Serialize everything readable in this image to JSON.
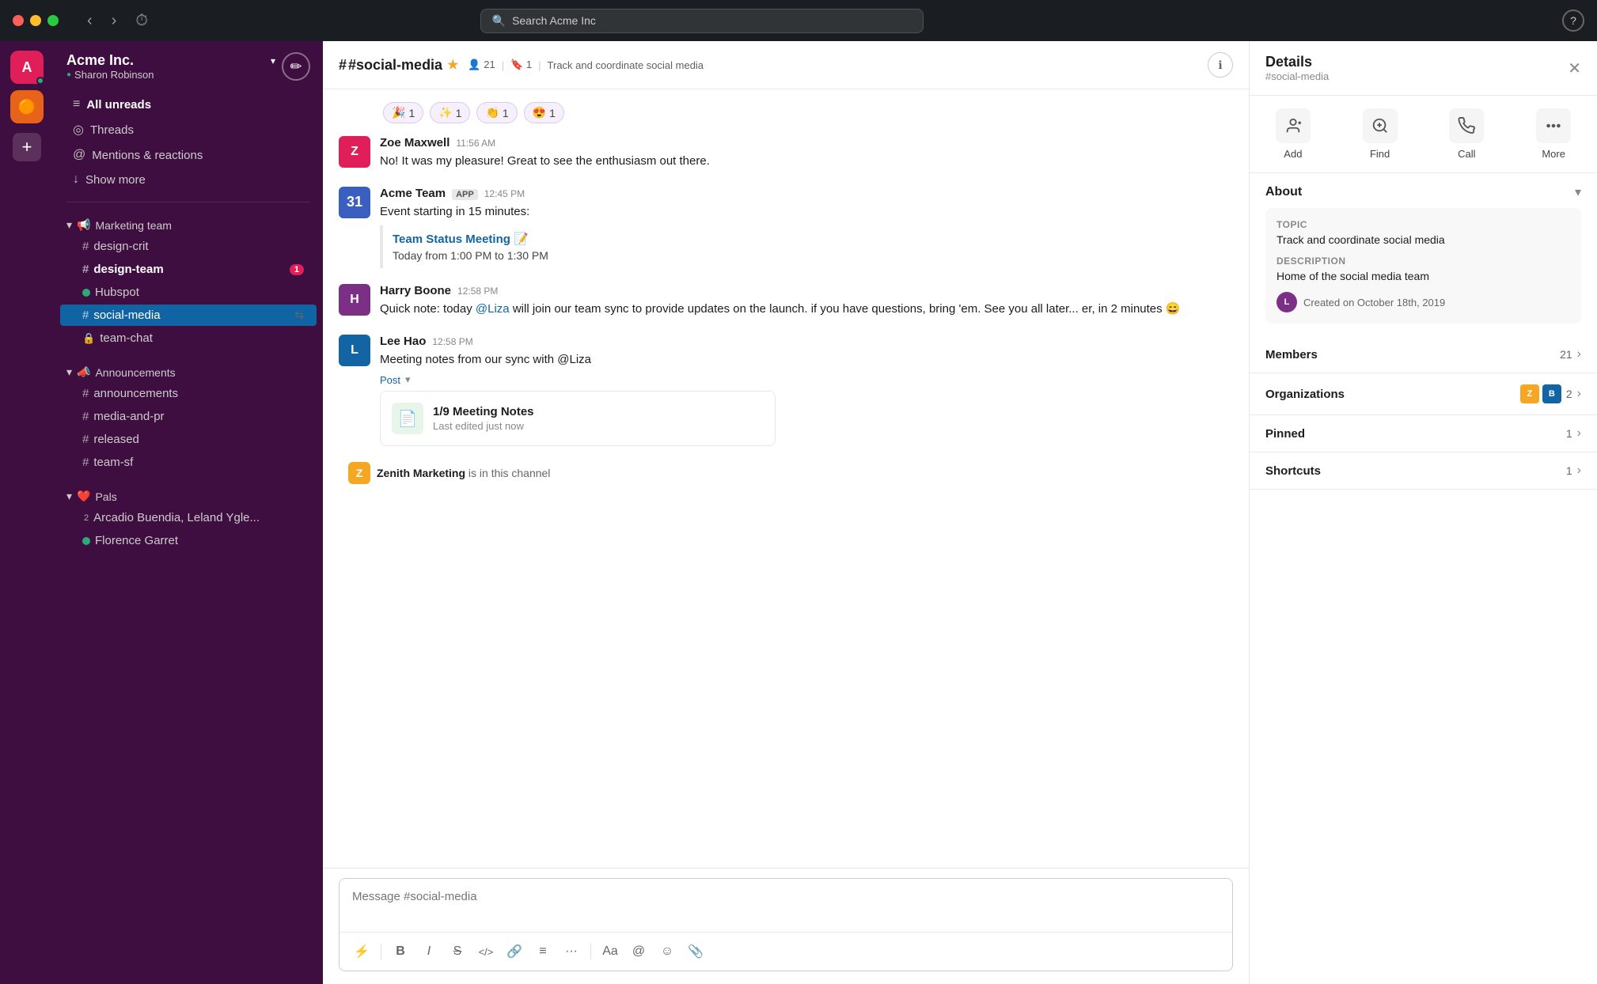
{
  "titlebar": {
    "search_placeholder": "Search Acme Inc"
  },
  "sidebar": {
    "workspace_name": "Acme Inc.",
    "user_name": "Sharon Robinson",
    "nav_items": [
      {
        "id": "all-unreads",
        "label": "All unreads",
        "icon": "≡"
      },
      {
        "id": "threads",
        "label": "Threads",
        "icon": "◎"
      },
      {
        "id": "mentions",
        "label": "Mentions & reactions",
        "icon": "@"
      },
      {
        "id": "show-more",
        "label": "Show more",
        "icon": "↓"
      }
    ],
    "marketing_section": {
      "label": "Marketing team",
      "emoji": "📢",
      "channels": [
        {
          "id": "design-crit",
          "name": "design-crit",
          "bold": false
        },
        {
          "id": "design-team",
          "name": "design-team",
          "bold": true,
          "badge": "1"
        },
        {
          "id": "hubspot",
          "name": "Hubspot",
          "type": "dot",
          "bold": false
        },
        {
          "id": "social-media",
          "name": "social-media",
          "bold": true,
          "active": true
        },
        {
          "id": "team-chat",
          "name": "team-chat",
          "type": "lock",
          "bold": false
        }
      ]
    },
    "announcements_section": {
      "label": "Announcements",
      "emoji": "📣",
      "channels": [
        {
          "id": "announcements",
          "name": "announcements",
          "bold": false
        },
        {
          "id": "media-and-pr",
          "name": "media-and-pr",
          "bold": false
        },
        {
          "id": "released",
          "name": "released",
          "bold": false
        },
        {
          "id": "team-sf",
          "name": "team-sf",
          "bold": false
        }
      ]
    },
    "pals_section": {
      "label": "Pals",
      "emoji": "❤️",
      "dms": [
        {
          "id": "dm1",
          "name": "Arcadio Buendia, Leland Ygle...",
          "num": "2"
        },
        {
          "id": "dm2",
          "name": "Florence Garret",
          "type": "dot"
        }
      ]
    }
  },
  "chat": {
    "channel_name": "#social-media",
    "channel_members": "21",
    "channel_bookmarks": "1",
    "channel_topic": "Track and coordinate social media",
    "reactions": [
      {
        "emoji": "🎉",
        "count": "1"
      },
      {
        "emoji": "✨",
        "count": "1"
      },
      {
        "emoji": "👏",
        "count": "1"
      },
      {
        "emoji": "😍",
        "count": "1"
      }
    ],
    "messages": [
      {
        "id": "msg1",
        "author": "Zoe Maxwell",
        "time": "11:56 AM",
        "avatar_text": "Z",
        "avatar_class": "zoe",
        "text": "No! It was my pleasure! Great to see the enthusiasm out there."
      },
      {
        "id": "msg2",
        "author": "Acme Team",
        "time": "12:45 PM",
        "avatar_text": "31",
        "avatar_class": "acme",
        "badge": "APP",
        "text": "Event starting in 15 minutes:",
        "event": {
          "title": "Team Status Meeting 📝",
          "time": "Today from 1:00 PM to 1:30 PM"
        }
      },
      {
        "id": "msg3",
        "author": "Harry Boone",
        "time": "12:58 PM",
        "avatar_text": "H",
        "avatar_class": "harry",
        "text_parts": [
          "Quick note: today ",
          "@Liza",
          " will join our team sync to provide updates on the launch. if you have questions, bring 'em. See you all later... er, in 2 minutes 😄"
        ]
      },
      {
        "id": "msg4",
        "author": "Lee Hao",
        "time": "12:58 PM",
        "avatar_text": "L",
        "avatar_class": "lee",
        "text": "Meeting notes from our sync with @Liza",
        "post": {
          "title": "1/9 Meeting Notes",
          "subtitle": "Last edited just now"
        }
      }
    ],
    "system_message": "Zenith Marketing is in this channel",
    "input_placeholder": "Message #social-media",
    "toolbar_buttons": [
      "⚡",
      "B",
      "I",
      "S̶",
      "</>",
      "🔗",
      "≡",
      "···",
      "Aa",
      "@",
      "☺",
      "📎"
    ]
  },
  "details_panel": {
    "title": "Details",
    "subtitle": "#social-media",
    "actions": [
      {
        "id": "add",
        "icon": "👤+",
        "label": "Add"
      },
      {
        "id": "find",
        "icon": "🔍",
        "label": "Find"
      },
      {
        "id": "call",
        "icon": "📞",
        "label": "Call"
      },
      {
        "id": "more",
        "icon": "···",
        "label": "More"
      }
    ],
    "about_title": "About",
    "topic_label": "Topic",
    "topic_value": "Track and coordinate social media",
    "description_label": "Description",
    "description_value": "Home of the social media team",
    "created_text": "Created on October 18th, 2019",
    "members_label": "Members",
    "members_count": "21",
    "organizations_label": "Organizations",
    "organizations_count": "2",
    "pinned_label": "Pinned",
    "pinned_count": "1",
    "shortcuts_label": "Shortcuts",
    "shortcuts_count": "1"
  }
}
